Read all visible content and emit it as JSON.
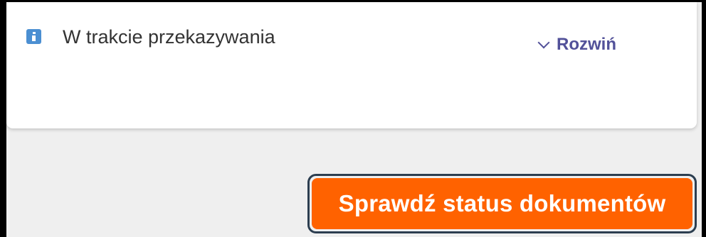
{
  "status": {
    "icon": "info-icon",
    "text": "W trakcie przekazywania"
  },
  "expand": {
    "icon": "chevron-down-icon",
    "label": "Rozwiń"
  },
  "check_button": {
    "label": "Sprawdź status dokumentów"
  },
  "colors": {
    "accent": "#525199",
    "button": "#ff6200",
    "info": "#4b8fd2"
  }
}
